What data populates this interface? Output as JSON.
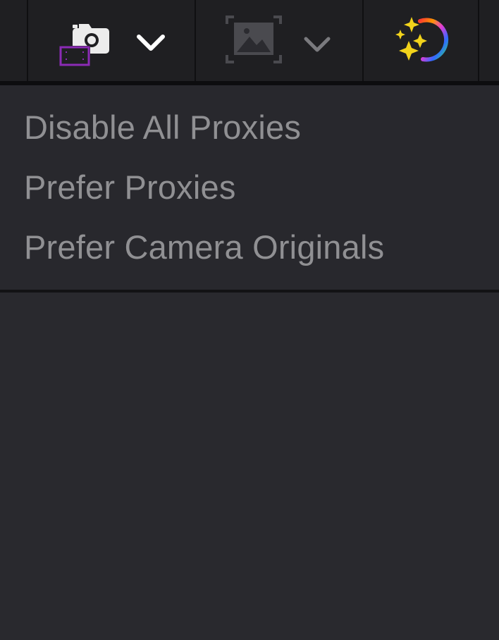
{
  "toolbar": {
    "buttons": [
      {
        "icon": "proxy-camera-icon",
        "accent": "#8b2bb5",
        "has_dropdown": true
      },
      {
        "icon": "image-frame-icon",
        "has_dropdown": true
      },
      {
        "icon": "sparkle-color-wheel-icon",
        "sparkle_color": "#f2d31b"
      }
    ]
  },
  "proxy_menu": {
    "items": [
      {
        "label": "Disable All Proxies"
      },
      {
        "label": "Prefer Proxies"
      },
      {
        "label": "Prefer Camera Originals"
      }
    ]
  },
  "colors": {
    "toolbar_bg": "#1f1f22",
    "menu_bg": "#28282d",
    "menu_text": "#909093",
    "panel_bg": "#29292e"
  }
}
